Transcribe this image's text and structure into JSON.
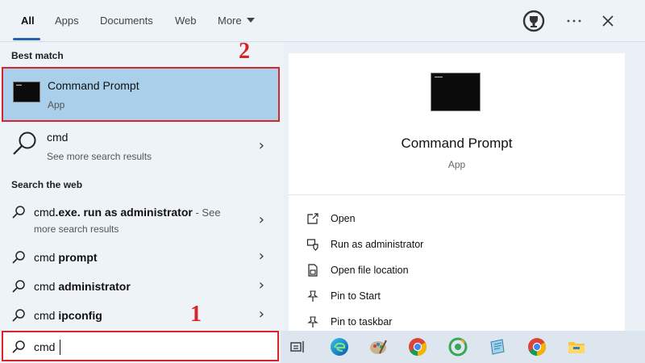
{
  "tabs": [
    {
      "label": "All",
      "active": true
    },
    {
      "label": "Apps"
    },
    {
      "label": "Documents"
    },
    {
      "label": "Web"
    },
    {
      "label": "More"
    }
  ],
  "top_icons": [
    "rewards-trophy-icon",
    "more-options-icon",
    "close-icon"
  ],
  "best_match": {
    "heading": "Best match",
    "title": "Command Prompt",
    "subtitle": "App"
  },
  "search_result": {
    "title": "cmd",
    "subtitle": "See more search results"
  },
  "web": {
    "heading": "Search the web",
    "items": [
      {
        "prefix": "cmd",
        "bold": ".exe. run as administrator",
        "suffix": " - See",
        "line2": "more search results"
      },
      {
        "prefix": "cmd ",
        "bold": "prompt"
      },
      {
        "prefix": "cmd ",
        "bold": "administrator"
      },
      {
        "prefix": "cmd ",
        "bold": "ipconfig"
      }
    ]
  },
  "search": {
    "value": "cmd"
  },
  "detail": {
    "title": "Command Prompt",
    "type": "App",
    "actions": [
      {
        "label": "Open",
        "icon": "open-icon"
      },
      {
        "label": "Run as administrator",
        "icon": "shield-icon"
      },
      {
        "label": "Open file location",
        "icon": "file-location-icon"
      },
      {
        "label": "Pin to Start",
        "icon": "pin-icon"
      },
      {
        "label": "Pin to taskbar",
        "icon": "pin-icon"
      }
    ]
  },
  "steps": {
    "one": "1",
    "two": "2"
  },
  "taskbar": [
    "task-view-icon",
    "edge-icon",
    "paint-icon",
    "chrome-icon",
    "coccoc-icon",
    "notepad-icon",
    "chrome-icon",
    "file-explorer-icon"
  ],
  "colors": {
    "highlight": "#a9cfea",
    "annotation_red": "#d6262b",
    "accent": "#2563ae"
  }
}
